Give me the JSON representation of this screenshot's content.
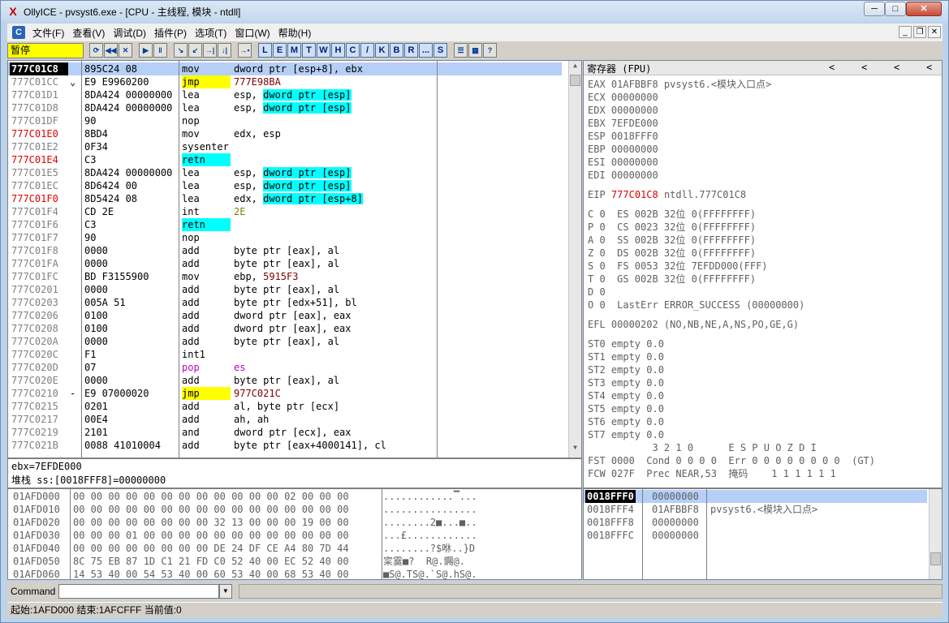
{
  "window": {
    "title": "OllyICE - pvsyst6.exe - [CPU - 主线程, 模块 - ntdll]",
    "logo": "X",
    "min": "─",
    "max": "□",
    "close": "✕"
  },
  "menu": [
    "文件(F)",
    "查看(V)",
    "调试(D)",
    "插件(P)",
    "选项(T)",
    "窗口(W)",
    "帮助(H)"
  ],
  "toolbar": {
    "status": "暂停",
    "play_group": [
      "▶",
      "‖"
    ],
    "step_group": [
      "↘",
      "↙",
      "→|",
      "↓|"
    ],
    "view_buttons": [
      "L",
      "E",
      "M",
      "T",
      "W",
      "H",
      "C",
      "/",
      "K",
      "B",
      "R",
      "...",
      "S"
    ]
  },
  "cpu_rows": [
    {
      "addr": "777C01C8",
      "mark": "",
      "hex": "895C24 08",
      "mn": "mov",
      "op": "dword ptr [esp+8], ebx",
      "addr_style": "sel",
      "op_style": "",
      "mn_style": ""
    },
    {
      "addr": "777C01CC",
      "mark": "⌄",
      "hex": "E9 E9960200",
      "mn": "jmp",
      "op": "777E98BA",
      "mn_style": "yel",
      "op_style": "dkred"
    },
    {
      "addr": "777C01D1",
      "mark": "",
      "hex": "8DA424 00000000",
      "mn": "lea",
      "op": "esp, dword ptr [esp]",
      "op_style": "cyanpart"
    },
    {
      "addr": "777C01D8",
      "mark": "",
      "hex": "8DA424 00000000",
      "mn": "lea",
      "op": "esp, dword ptr [esp]",
      "op_style": "cyanpart"
    },
    {
      "addr": "777C01DF",
      "mark": "",
      "hex": "90",
      "mn": "nop",
      "op": ""
    },
    {
      "addr": "777C01E0",
      "mark": "",
      "hex": "8BD4",
      "mn": "mov",
      "op": "edx, esp",
      "addr_style": "red"
    },
    {
      "addr": "777C01E2",
      "mark": "",
      "hex": "0F34",
      "mn": "sysenter",
      "op": ""
    },
    {
      "addr": "777C01E4",
      "mark": "",
      "hex": "C3",
      "mn": "retn",
      "op": "",
      "addr_style": "red",
      "mn_style": "cyan"
    },
    {
      "addr": "777C01E5",
      "mark": "",
      "hex": "8DA424 00000000",
      "mn": "lea",
      "op": "esp, dword ptr [esp]",
      "op_style": "cyanpart"
    },
    {
      "addr": "777C01EC",
      "mark": "",
      "hex": "8D6424 00",
      "mn": "lea",
      "op": "esp, dword ptr [esp]",
      "op_style": "cyanpart"
    },
    {
      "addr": "777C01F0",
      "mark": "",
      "hex": "8D5424 08",
      "mn": "lea",
      "op": "edx, dword ptr [esp+8]",
      "addr_style": "red",
      "op_style": "cyanpart"
    },
    {
      "addr": "777C01F4",
      "mark": "",
      "hex": "CD 2E",
      "mn": "int",
      "op": "2E",
      "op_style": "olive"
    },
    {
      "addr": "777C01F6",
      "mark": "",
      "hex": "C3",
      "mn": "retn",
      "op": "",
      "mn_style": "cyan"
    },
    {
      "addr": "777C01F7",
      "mark": "",
      "hex": "90",
      "mn": "nop",
      "op": ""
    },
    {
      "addr": "777C01F8",
      "mark": "",
      "hex": "0000",
      "mn": "add",
      "op": "byte ptr [eax], al"
    },
    {
      "addr": "777C01FA",
      "mark": "",
      "hex": "0000",
      "mn": "add",
      "op": "byte ptr [eax], al"
    },
    {
      "addr": "777C01FC",
      "mark": "",
      "hex": "BD F3155900",
      "mn": "mov",
      "op": "ebp, 5915F3",
      "op_style": "dkredpart"
    },
    {
      "addr": "777C0201",
      "mark": "",
      "hex": "0000",
      "mn": "add",
      "op": "byte ptr [eax], al"
    },
    {
      "addr": "777C0203",
      "mark": "",
      "hex": "005A 51",
      "mn": "add",
      "op": "byte ptr [edx+51], bl"
    },
    {
      "addr": "777C0206",
      "mark": "",
      "hex": "0100",
      "mn": "add",
      "op": "dword ptr [eax], eax"
    },
    {
      "addr": "777C0208",
      "mark": "",
      "hex": "0100",
      "mn": "add",
      "op": "dword ptr [eax], eax"
    },
    {
      "addr": "777C020A",
      "mark": "",
      "hex": "0000",
      "mn": "add",
      "op": "byte ptr [eax], al"
    },
    {
      "addr": "777C020C",
      "mark": "",
      "hex": "F1",
      "mn": "int1",
      "op": ""
    },
    {
      "addr": "777C020D",
      "mark": "",
      "hex": "07",
      "mn": "pop",
      "op": "es",
      "mn_style": "mag",
      "op_style": "mag"
    },
    {
      "addr": "777C020E",
      "mark": "",
      "hex": "0000",
      "mn": "add",
      "op": "byte ptr [eax], al"
    },
    {
      "addr": "777C0210",
      "mark": "-",
      "hex": "E9 07000020",
      "mn": "jmp",
      "op": "977C021C",
      "mn_style": "yel",
      "op_style": "dkred"
    },
    {
      "addr": "777C0215",
      "mark": "",
      "hex": "0201",
      "mn": "add",
      "op": "al, byte ptr [ecx]"
    },
    {
      "addr": "777C0217",
      "mark": "",
      "hex": "00E4",
      "mn": "add",
      "op": "ah, ah"
    },
    {
      "addr": "777C0219",
      "mark": "",
      "hex": "2101",
      "mn": "and",
      "op": "dword ptr [ecx], eax"
    },
    {
      "addr": "777C021B",
      "mark": "",
      "hex": "0088 41010004",
      "mn": "add",
      "op": "byte ptr [eax+4000141], cl"
    }
  ],
  "info": {
    "line1": "ebx=7EFDE000",
    "line2": "堆栈 ss:[0018FFF8]=00000000"
  },
  "registers": {
    "header": "寄存器 (FPU)",
    "header_arrows": [
      "<",
      "<",
      "<",
      "<"
    ],
    "gp": [
      {
        "name": "EAX",
        "value": "01AFBBF8",
        "comment": "pvsyst6.<模块入口点>"
      },
      {
        "name": "ECX",
        "value": "00000000",
        "comment": ""
      },
      {
        "name": "EDX",
        "value": "00000000",
        "comment": ""
      },
      {
        "name": "EBX",
        "value": "7EFDE000",
        "comment": ""
      },
      {
        "name": "ESP",
        "value": "0018FFF0",
        "comment": ""
      },
      {
        "name": "EBP",
        "value": "00000000",
        "comment": ""
      },
      {
        "name": "ESI",
        "value": "00000000",
        "comment": ""
      },
      {
        "name": "EDI",
        "value": "00000000",
        "comment": ""
      }
    ],
    "eip": {
      "name": "EIP",
      "value": "777C01C8",
      "comment": "ntdll.777C01C8"
    },
    "flags": [
      {
        "f": "C 0",
        "seg": "ES 002B 32位 0(FFFFFFFF)"
      },
      {
        "f": "P 0",
        "seg": "CS 0023 32位 0(FFFFFFFF)"
      },
      {
        "f": "A 0",
        "seg": "SS 002B 32位 0(FFFFFFFF)"
      },
      {
        "f": "Z 0",
        "seg": "DS 002B 32位 0(FFFFFFFF)"
      },
      {
        "f": "S 0",
        "seg": "FS 0053 32位 7EFDD000(FFF)"
      },
      {
        "f": "T 0",
        "seg": "GS 002B 32位 0(FFFFFFFF)"
      },
      {
        "f": "D 0",
        "seg": ""
      },
      {
        "f": "O 0",
        "seg": "LastErr ERROR_SUCCESS (00000000)"
      }
    ],
    "efl": "EFL 00000202 (NO,NB,NE,A,NS,PO,GE,G)",
    "fpu": [
      "ST0 empty 0.0",
      "ST1 empty 0.0",
      "ST2 empty 0.0",
      "ST3 empty 0.0",
      "ST4 empty 0.0",
      "ST5 empty 0.0",
      "ST6 empty 0.0",
      "ST7 empty 0.0"
    ],
    "fpu_hdr": "           3 2 1 0      E S P U O Z D I",
    "fst": "FST 0000  Cond 0 0 0 0  Err 0 0 0 0 0 0 0 0  (GT)",
    "fcw": "FCW 027F  Prec NEAR,53  掩码    1 1 1 1 1 1"
  },
  "dump": [
    {
      "addr": "01AFD000",
      "hex": "00 00 00 00 00 00 00 00 00 00 00 00 02 00 00 00",
      "ascii": "............▔..."
    },
    {
      "addr": "01AFD010",
      "hex": "00 00 00 00 00 00 00 00 00 00 00 00 00 00 00 00",
      "ascii": "................"
    },
    {
      "addr": "01AFD020",
      "hex": "00 00 00 00 00 00 00 00 32 13 00 00 00 19 00 00",
      "ascii": "........2■...■.."
    },
    {
      "addr": "01AFD030",
      "hex": "00 00 00 01 00 00 00 00 00 00 00 00 00 00 00 00",
      "ascii": "...£............"
    },
    {
      "addr": "01AFD040",
      "hex": "00 00 00 00 00 00 00 00 DE 24 DF CE A4 80 7D 44",
      "ascii": "........?$咻..}D"
    },
    {
      "addr": "01AFD050",
      "hex": "8C 75 EB 87 1D C1 21 FD C0 52 40 00 EC 52 40 00",
      "ascii": "寀霙■?  R@.鐊@."
    },
    {
      "addr": "01AFD060",
      "hex": "14 53 40 00 54 53 40 00 60 53 40 00 68 53 40 00",
      "ascii": "■S@.TS@.`S@.hS@."
    }
  ],
  "stack": [
    {
      "addr": "0018FFF0",
      "value": "00000000",
      "comment": ""
    },
    {
      "addr": "0018FFF4",
      "value": "01AFBBF8",
      "comment": "pvsyst6.<模块入口点>"
    },
    {
      "addr": "0018FFF8",
      "value": "00000000",
      "comment": ""
    },
    {
      "addr": "0018FFFC",
      "value": "00000000",
      "comment": ""
    }
  ],
  "command": {
    "label": "Command",
    "value": ""
  },
  "status_bar": "起始:1AFD000 结束:1AFCFFF 当前值:0",
  "colors": {
    "selection": "#000000",
    "highlight_row": "#b6cff7",
    "cyan": "#00ffff",
    "yellow": "#ffff00",
    "red": "#e00000"
  }
}
